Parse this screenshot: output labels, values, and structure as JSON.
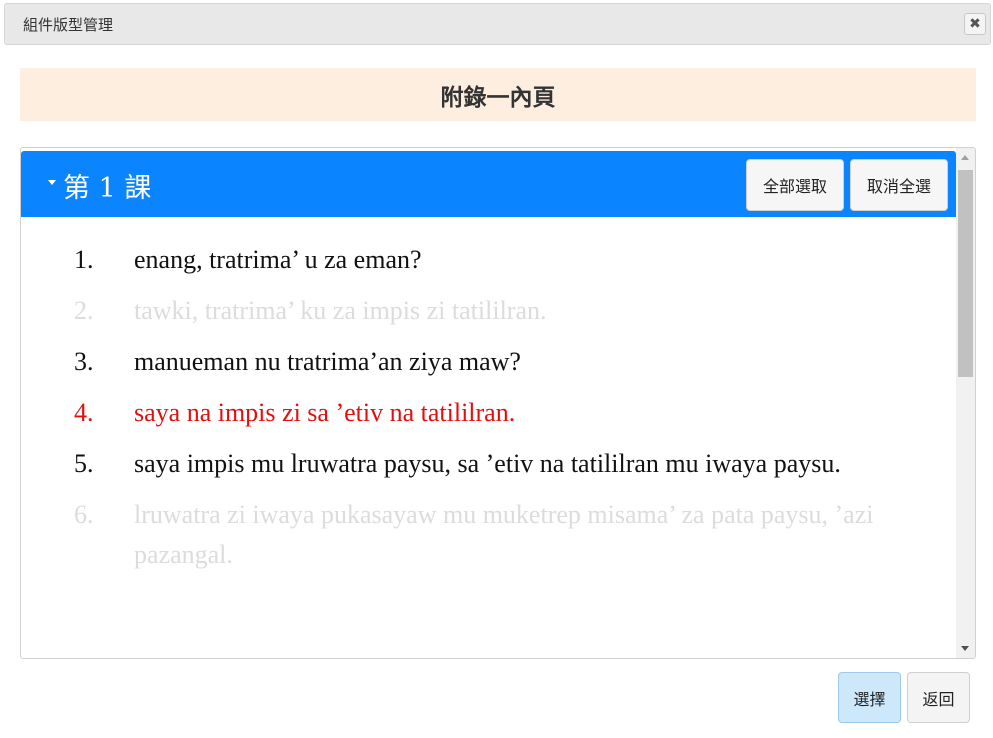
{
  "dialog": {
    "title": "組件版型管理",
    "close_icon": "✖"
  },
  "heading": "附錄一內頁",
  "lesson": {
    "title": "第 1 課",
    "select_all_label": "全部選取",
    "deselect_all_label": "取消全選"
  },
  "sentences": [
    {
      "num": "1.",
      "text": "enang, tratrima’ u za eman?",
      "state": "normal"
    },
    {
      "num": "2.",
      "text": "tawki, tratrima’ ku za impis zi tatililran.",
      "state": "dimmed"
    },
    {
      "num": "3.",
      "text": "manueman nu tratrima’an ziya maw?",
      "state": "normal"
    },
    {
      "num": "4.",
      "text": "saya na impis zi sa ’etiv na tatililran.",
      "state": "highlight"
    },
    {
      "num": "5.",
      "text": "saya impis mu lruwatra paysu, sa ’etiv na tatililran mu iwaya paysu.",
      "state": "normal"
    },
    {
      "num": "6.",
      "text": "lruwatra zi iwaya pukasayaw mu muketrep misama’ za pata paysu, ’azi pazangal.",
      "state": "dimmed"
    }
  ],
  "footer": {
    "select_label": "選擇",
    "back_label": "返回"
  },
  "colors": {
    "header_blue": "#0a84ff",
    "heading_bg": "#fdeee0",
    "highlight_red": "#e01010",
    "dimmed_gray": "#dcdcdc",
    "select_button_bg": "#cde8fb"
  }
}
